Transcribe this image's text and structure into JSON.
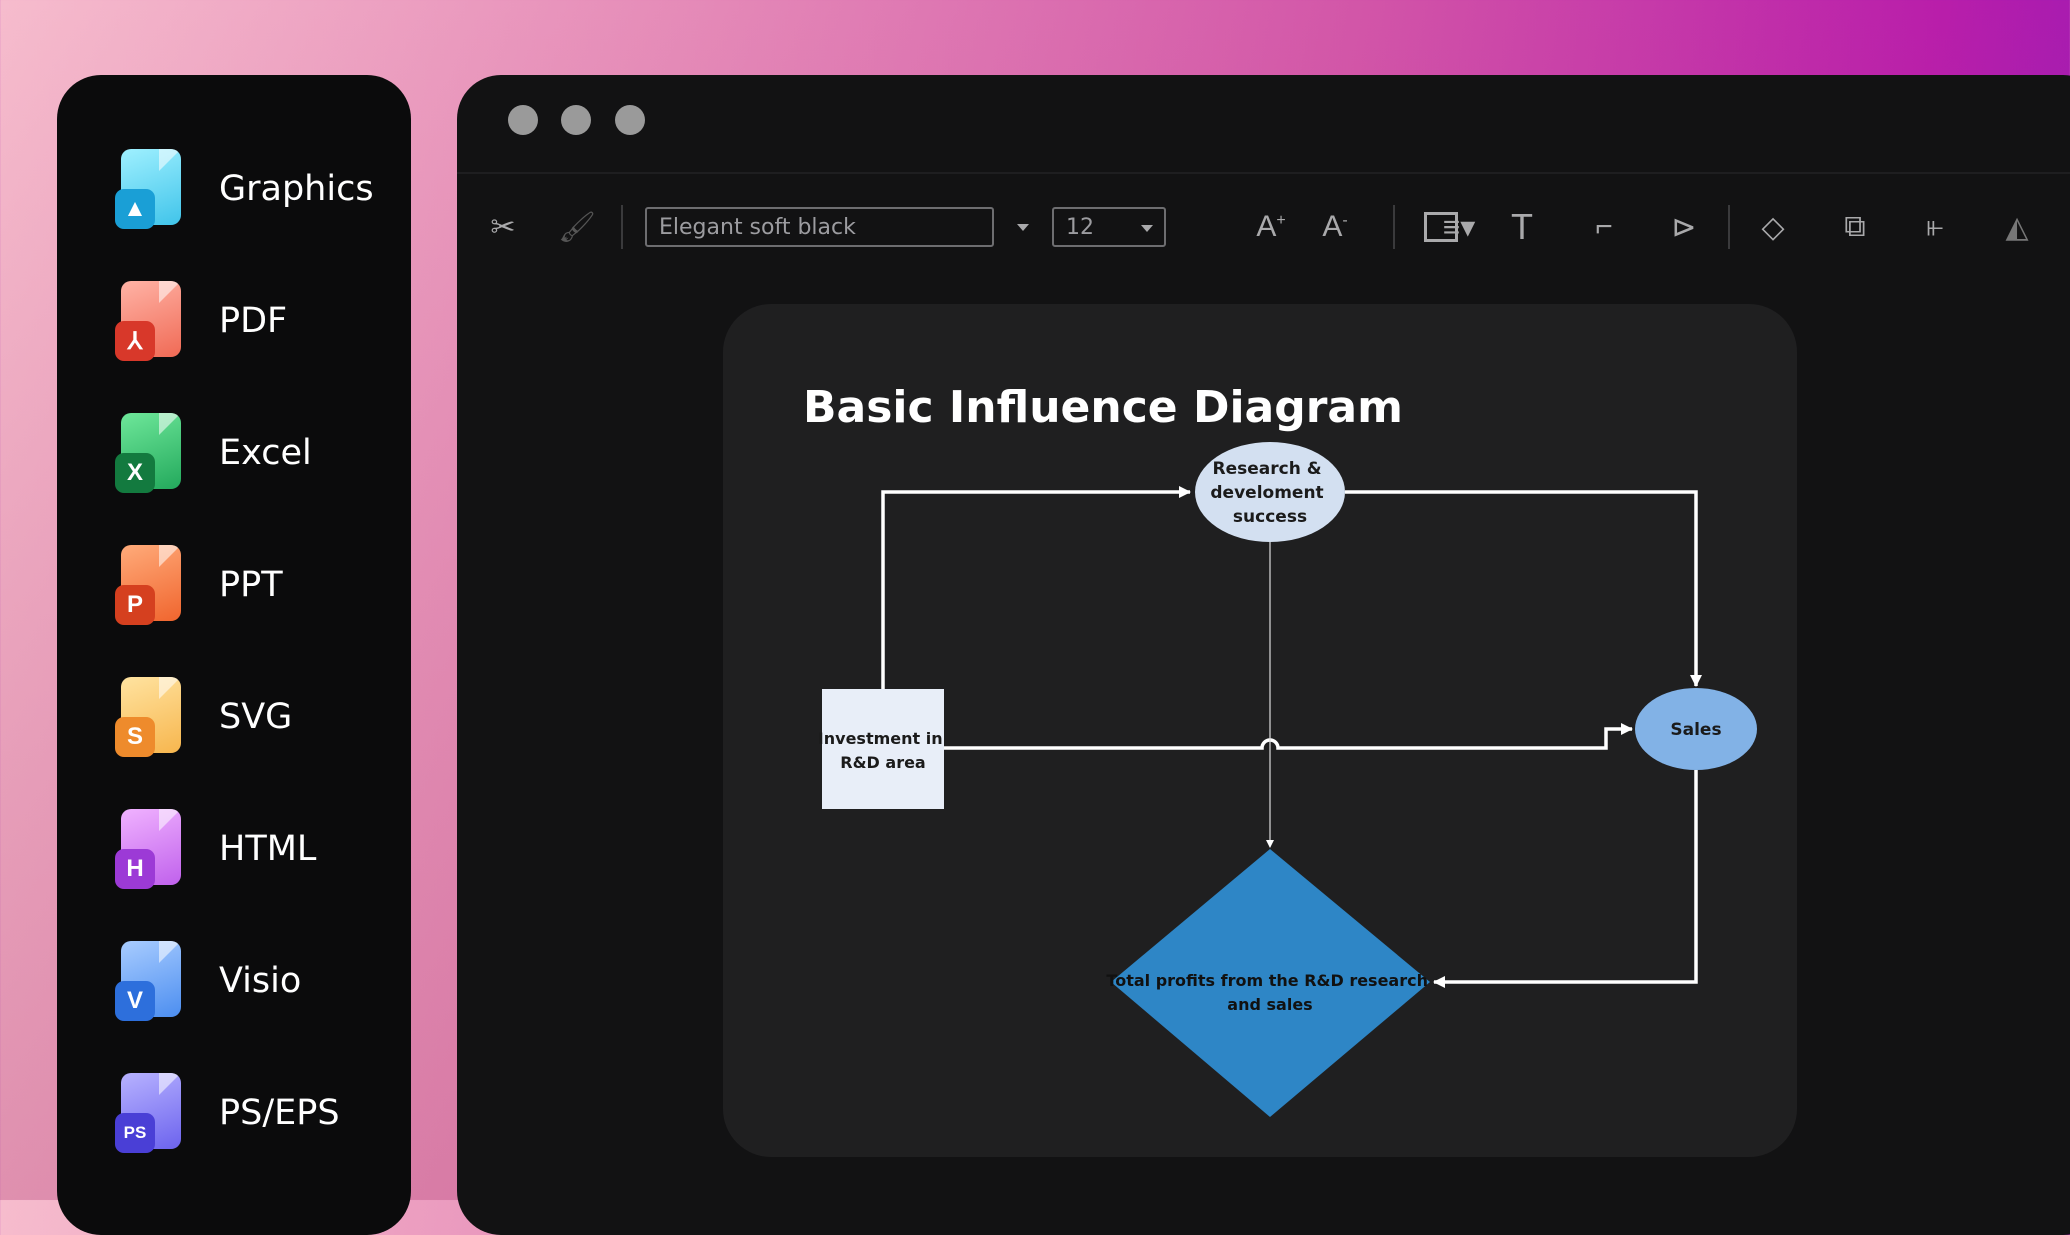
{
  "sidebar": {
    "items": [
      {
        "label": "Graphics",
        "icon": "image-file-icon",
        "color": "#38b6e8",
        "badge": ""
      },
      {
        "label": "PDF",
        "icon": "pdf-file-icon",
        "color": "#e04a3a",
        "badge": "⅄"
      },
      {
        "label": "Excel",
        "icon": "excel-file-icon",
        "color": "#1e9a55",
        "badge": "X"
      },
      {
        "label": "PPT",
        "icon": "ppt-file-icon",
        "color": "#ea5a2c",
        "badge": "P"
      },
      {
        "label": "SVG",
        "icon": "svg-file-icon",
        "color": "#f3a23e",
        "badge": "S"
      },
      {
        "label": "HTML",
        "icon": "html-file-icon",
        "color": "#b04ee0",
        "badge": "H"
      },
      {
        "label": "Visio",
        "icon": "visio-file-icon",
        "color": "#3d7fe6",
        "badge": "V"
      },
      {
        "label": "PS/EPS",
        "icon": "ps-eps-file-icon",
        "color": "#5b55e0",
        "badge": "PS"
      }
    ]
  },
  "toolbar": {
    "font": "Elegant soft black",
    "size": "12"
  },
  "diagram": {
    "title": "Basic Influence Diagram",
    "nodes": {
      "rd": {
        "line1": "Research &",
        "line2": "develoment",
        "line3": "success",
        "color": "#d3e0f1"
      },
      "investment": {
        "line1": "Investment in",
        "line2": "R&D area",
        "color": "#e8eef8"
      },
      "sales": {
        "label": "Sales",
        "color": "#82b2e6"
      },
      "profits": {
        "line1": "Total profits from the R&D research",
        "line2": "and sales",
        "color": "#2e86c6"
      }
    }
  }
}
